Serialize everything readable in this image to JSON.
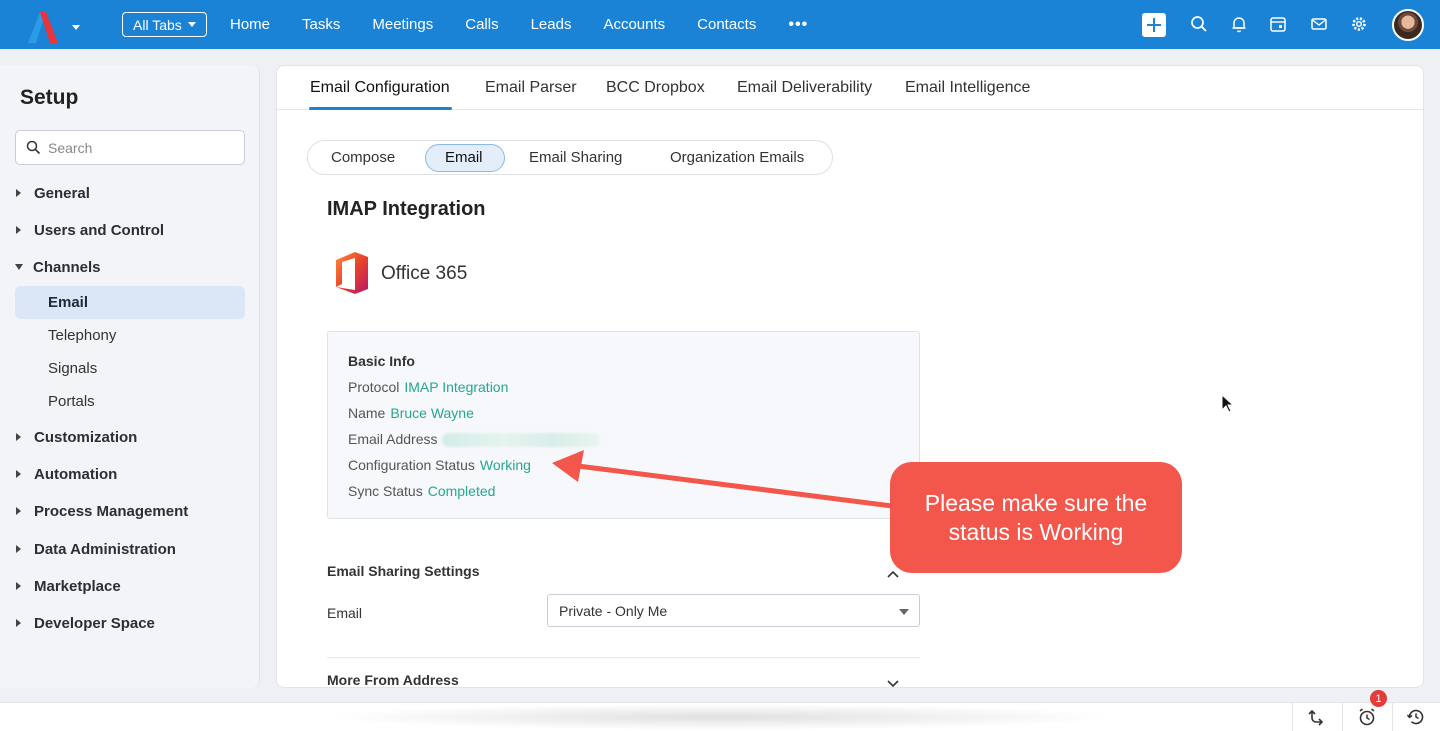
{
  "topbar": {
    "all_tabs_label": "All Tabs",
    "nav": [
      "Home",
      "Tasks",
      "Meetings",
      "Calls",
      "Leads",
      "Accounts",
      "Contacts"
    ],
    "more": "•••",
    "icons": [
      "plus-icon",
      "search-icon",
      "bell-icon",
      "calendar-icon",
      "mail-icon",
      "gear-icon",
      "avatar"
    ]
  },
  "sidebar": {
    "title": "Setup",
    "search_placeholder": "Search",
    "groups": [
      {
        "label": "General",
        "expanded": false
      },
      {
        "label": "Users and Control",
        "expanded": false
      },
      {
        "label": "Channels",
        "expanded": true
      },
      {
        "label": "Customization",
        "expanded": false
      },
      {
        "label": "Automation",
        "expanded": false
      },
      {
        "label": "Process Management",
        "expanded": false
      },
      {
        "label": "Data Administration",
        "expanded": false
      },
      {
        "label": "Marketplace",
        "expanded": false
      },
      {
        "label": "Developer Space",
        "expanded": false
      }
    ],
    "channel_items": [
      {
        "label": "Email",
        "active": true
      },
      {
        "label": "Telephony",
        "active": false
      },
      {
        "label": "Signals",
        "active": false
      },
      {
        "label": "Portals",
        "active": false
      }
    ]
  },
  "main": {
    "tabs": [
      "Email Configuration",
      "Email Parser",
      "BCC Dropbox",
      "Email Deliverability",
      "Email Intelligence"
    ],
    "active_tab": "Email Configuration",
    "subtabs": [
      "Compose",
      "Email",
      "Email Sharing",
      "Organization Emails"
    ],
    "active_subtab": "Email",
    "section_title": "IMAP Integration",
    "provider": "Office 365",
    "basic_info": {
      "title": "Basic Info",
      "protocol_label": "Protocol",
      "protocol_value": "IMAP Integration",
      "name_label": "Name",
      "name_value": "Bruce Wayne",
      "email_label": "Email Address",
      "config_status_label": "Configuration Status",
      "config_status_value": "Working",
      "sync_status_label": "Sync Status",
      "sync_status_value": "Completed"
    },
    "email_sharing": {
      "title": "Email Sharing Settings",
      "email_label": "Email",
      "email_value": "Private - Only Me"
    },
    "more_from_address": "More From Address"
  },
  "annotation": {
    "text": "Please make sure the status is Working",
    "color": "#f3564b"
  },
  "bottombar": {
    "badge_count": "1"
  },
  "colors": {
    "topbar": "#1a83d6",
    "accent_green": "#27a68f"
  }
}
